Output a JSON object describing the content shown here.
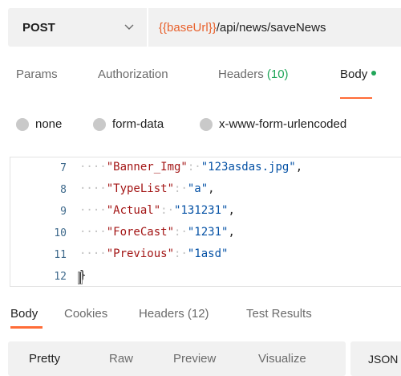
{
  "request": {
    "method": "POST",
    "url_variable": "{{baseUrl}}",
    "url_path": "/api/news/saveNews"
  },
  "request_tabs": {
    "params": "Params",
    "authorization": "Authorization",
    "headers": "Headers",
    "headers_count": "(10)",
    "body": "Body"
  },
  "body_types": {
    "none": "none",
    "form_data": "form-data",
    "urlencoded": "x-www-form-urlencoded"
  },
  "editor": {
    "lines": [
      {
        "num": "7",
        "indent": "····",
        "key": "\"Banner_Img\"",
        "sep": ":·",
        "value": "\"123asdas.jpg\"",
        "end": ","
      },
      {
        "num": "8",
        "indent": "····",
        "key": "\"TypeList\"",
        "sep": ":·",
        "value": "\"a\"",
        "end": ","
      },
      {
        "num": "9",
        "indent": "····",
        "key": "\"Actual\"",
        "sep": ":·",
        "value": "\"131231\"",
        "end": ","
      },
      {
        "num": "10",
        "indent": "····",
        "key": "\"ForeCast\"",
        "sep": ":·",
        "value": "\"1231\"",
        "end": ","
      },
      {
        "num": "11",
        "indent": "····",
        "key": "\"Previous\"",
        "sep": ":·",
        "value": "\"1asd\"",
        "end": ""
      },
      {
        "num": "12",
        "indent": "",
        "key": "",
        "sep": "",
        "value": "",
        "end": "}"
      }
    ]
  },
  "response_tabs": {
    "body": "Body",
    "cookies": "Cookies",
    "headers": "Headers (12)",
    "test_results": "Test Results"
  },
  "view_modes": {
    "pretty": "Pretty",
    "raw": "Raw",
    "preview": "Preview",
    "visualize": "Visualize",
    "format": "JSON"
  },
  "colors": {
    "accent": "#ff6c37",
    "success": "#21a659",
    "url_variable": "#e8612c",
    "json_key": "#a31515",
    "json_value": "#0451a5"
  }
}
